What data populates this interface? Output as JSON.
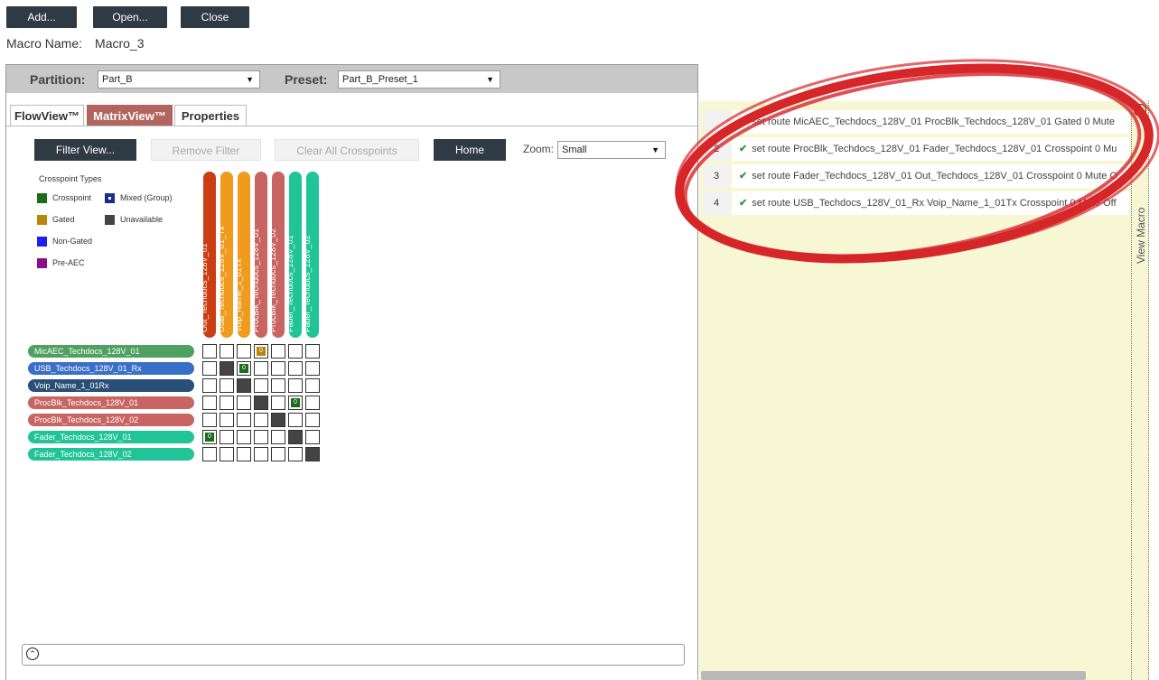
{
  "toolbar": {
    "add": "Add...",
    "open": "Open...",
    "close": "Close"
  },
  "macro": {
    "label": "Macro Name:",
    "value": "Macro_3"
  },
  "partition": {
    "label": "Partition:",
    "value": "Part_B"
  },
  "preset": {
    "label": "Preset:",
    "value": "Part_B_Preset_1"
  },
  "tabs": {
    "flow": "FlowView™",
    "matrix": "MatrixView™",
    "properties": "Properties"
  },
  "filters": {
    "filter_view": "Filter View...",
    "remove_filter": "Remove Filter",
    "clear_all": "Clear All Crosspoints",
    "home": "Home",
    "zoom_label": "Zoom:",
    "zoom_value": "Small"
  },
  "legend": {
    "title": "Crosspoint Types",
    "items": [
      {
        "label": "Crosspoint",
        "color": "#1d6b1d"
      },
      {
        "label": "Mixed (Group)",
        "color": "#1a2d8a"
      },
      {
        "label": "Gated",
        "color": "#b8860b"
      },
      {
        "label": "Unavailable",
        "color": "#444444"
      },
      {
        "label": "Non-Gated",
        "color": "#1e1ef0"
      },
      {
        "label": "Pre-AEC",
        "color": "#8a0f8a"
      }
    ]
  },
  "columns": [
    {
      "label": "Out_Techdocs_128V_01",
      "color": "#cc3d14"
    },
    {
      "label": "USB_Techdocs_128V_01_Tx",
      "color": "#f09a1e"
    },
    {
      "label": "Voip_Name_1_01Tx",
      "color": "#f09a1e"
    },
    {
      "label": "ProcBlk_Techdocs_128V_01",
      "color": "#c86562"
    },
    {
      "label": "ProcBlk_Techdocs_128V_02",
      "color": "#c86562"
    },
    {
      "label": "Fader_Techdocs_128V_01",
      "color": "#21c497"
    },
    {
      "label": "Fader_Techdocs_128V_02",
      "color": "#21c497"
    }
  ],
  "rows": [
    {
      "label": "MicAEC_Techdocs_128V_01",
      "color": "#4ea160"
    },
    {
      "label": "USB_Techdocs_128V_01_Rx",
      "color": "#3a6fc8"
    },
    {
      "label": "Voip_Name_1_01Rx",
      "color": "#284f78"
    },
    {
      "label": "ProcBlk_Techdocs_128V_01",
      "color": "#c86562"
    },
    {
      "label": "ProcBlk_Techdocs_128V_02",
      "color": "#c86562"
    },
    {
      "label": "Fader_Techdocs_128V_01",
      "color": "#21c497"
    },
    {
      "label": "Fader_Techdocs_128V_02",
      "color": "#21c497"
    }
  ],
  "matrix": [
    [
      "",
      "",
      "",
      "gated:0",
      "",
      "",
      ""
    ],
    [
      "",
      "unav",
      "cross:0",
      "",
      "",
      "",
      ""
    ],
    [
      "",
      "",
      "unav",
      "",
      "",
      "",
      ""
    ],
    [
      "",
      "",
      "",
      "unav",
      "",
      "cross:0",
      ""
    ],
    [
      "",
      "",
      "",
      "",
      "unav",
      "",
      ""
    ],
    [
      "cross:0",
      "",
      "",
      "",
      "",
      "unav",
      ""
    ],
    [
      "",
      "",
      "",
      "",
      "",
      "",
      "unav"
    ]
  ],
  "commands": [
    {
      "num": "",
      "text": "set route MicAEC_Techdocs_128V_01 ProcBlk_Techdocs_128V_01 Gated 0 Mute"
    },
    {
      "num": "2",
      "text": "set route ProcBlk_Techdocs_128V_01 Fader_Techdocs_128V_01 Crosspoint 0 Mu"
    },
    {
      "num": "3",
      "text": "set route Fader_Techdocs_128V_01 Out_Techdocs_128V_01 Crosspoint 0 Mute O"
    },
    {
      "num": "4",
      "text": "set route USB_Techdocs_128V_01_Rx Voip_Name_1_01Tx Crosspoint 0 Mute Off"
    }
  ],
  "view_macro": "View Macro"
}
